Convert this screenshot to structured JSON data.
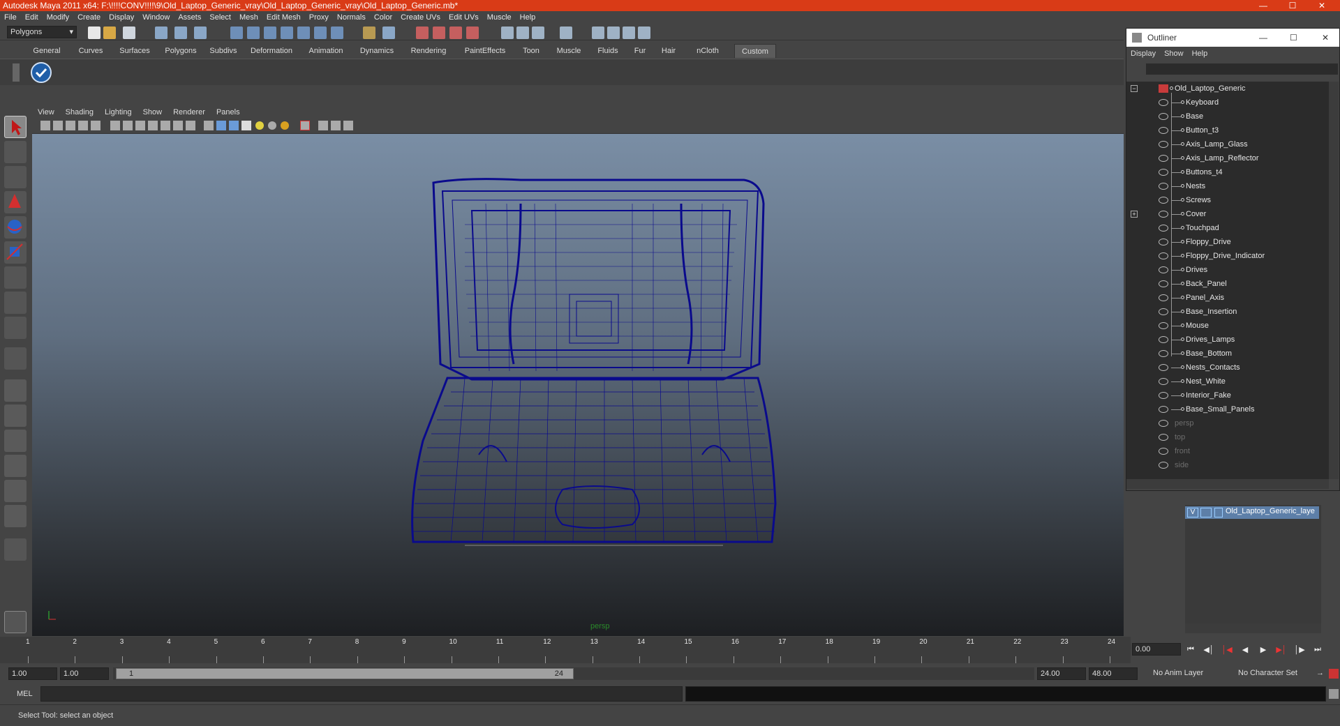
{
  "window": {
    "title": "Autodesk Maya 2011 x64: F:\\!!!!CONV!!!!\\9\\Old_Laptop_Generic_vray\\Old_Laptop_Generic_vray\\Old_Laptop_Generic.mb*",
    "accent_color": "#d93b17"
  },
  "menubar": [
    "File",
    "Edit",
    "Modify",
    "Create",
    "Display",
    "Window",
    "Assets",
    "Select",
    "Mesh",
    "Edit Mesh",
    "Proxy",
    "Normals",
    "Color",
    "Create UVs",
    "Edit UVs",
    "Muscle",
    "Help"
  ],
  "statusline": {
    "mode": "Polygons"
  },
  "shelf": {
    "tabs": [
      "General",
      "Curves",
      "Surfaces",
      "Polygons",
      "Subdivs",
      "Deformation",
      "Animation",
      "Dynamics",
      "Rendering",
      "PaintEffects",
      "Toon",
      "Muscle",
      "Fluids",
      "Fur",
      "Hair",
      "nCloth",
      "Custom"
    ],
    "active_tab": "Custom"
  },
  "viewport": {
    "menu": [
      "View",
      "Shading",
      "Lighting",
      "Show",
      "Renderer",
      "Panels"
    ],
    "camera_label": "persp",
    "wireframe_color": "#0a0a8c"
  },
  "outliner": {
    "title": "Outliner",
    "menu": [
      "Display",
      "Show",
      "Help"
    ],
    "root": "Old_Laptop_Generic",
    "children": [
      "Keyboard",
      "Base",
      "Button_t3",
      "Axis_Lamp_Glass",
      "Axis_Lamp_Reflector",
      "Buttons_t4",
      "Nests",
      "Screws",
      "Cover",
      "Touchpad",
      "Floppy_Drive",
      "Floppy_Drive_Indicator",
      "Drives",
      "Back_Panel",
      "Panel_Axis",
      "Base_Insertion",
      "Mouse",
      "Drives_Lamps",
      "Base_Bottom",
      "Nests_Contacts",
      "Nest_White",
      "Interior_Fake",
      "Base_Small_Panels"
    ],
    "cameras": [
      "persp",
      "top",
      "front",
      "side"
    ]
  },
  "layers": {
    "visible_flag": "V",
    "layer_name": "Old_Laptop_Generic_laye"
  },
  "timeline": {
    "ticks": [
      "1",
      "2",
      "3",
      "4",
      "5",
      "6",
      "7",
      "8",
      "9",
      "10",
      "11",
      "12",
      "13",
      "14",
      "15",
      "16",
      "17",
      "18",
      "19",
      "20",
      "21",
      "22",
      "23",
      "24"
    ],
    "current_time": "0.00"
  },
  "range": {
    "start": "1.00",
    "playback_start": "1.00",
    "slider_start": "1",
    "slider_end": "24",
    "playback_end": "24.00",
    "end": "48.00",
    "anim_layer": "No Anim Layer",
    "character_set": "No Character Set"
  },
  "command_line": {
    "label": "MEL"
  },
  "help_line": {
    "text": "Select Tool: select an object"
  }
}
